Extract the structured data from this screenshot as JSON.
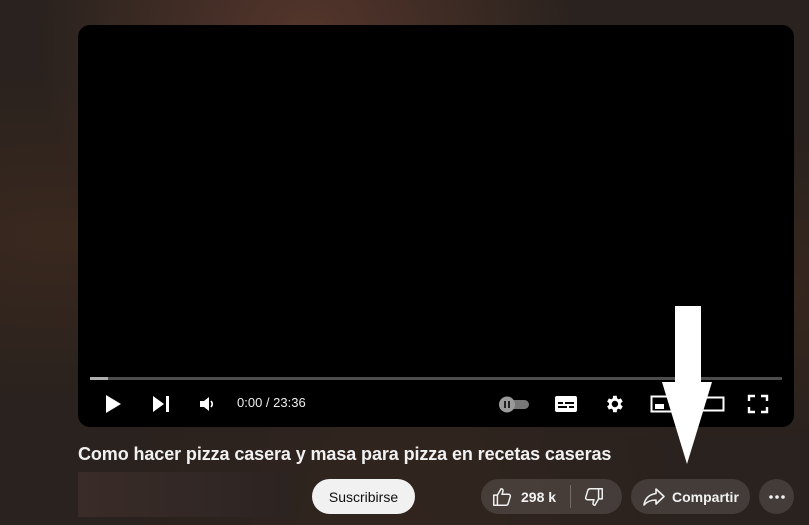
{
  "player": {
    "time_display": "0:00 / 23:36",
    "icons": {
      "play": "play-icon",
      "next": "next-icon",
      "volume": "volume-icon",
      "autoplay": "autoplay-toggle-icon",
      "subtitles": "subtitles-icon",
      "settings": "gear-icon",
      "miniplayer": "miniplayer-icon",
      "theater": "theater-mode-icon",
      "fullscreen": "fullscreen-icon"
    }
  },
  "video": {
    "title": "Como hacer pizza casera y masa para pizza en recetas caseras"
  },
  "actions": {
    "subscribe_label": "Suscribirse",
    "like_count": "298 k",
    "share_label": "Compartir",
    "icons": {
      "like": "thumbs-up-icon",
      "dislike": "thumbs-down-icon",
      "share": "share-icon",
      "more": "more-options-icon"
    }
  },
  "annotation": {
    "arrow_icon": "down-arrow-pointer-icon"
  }
}
